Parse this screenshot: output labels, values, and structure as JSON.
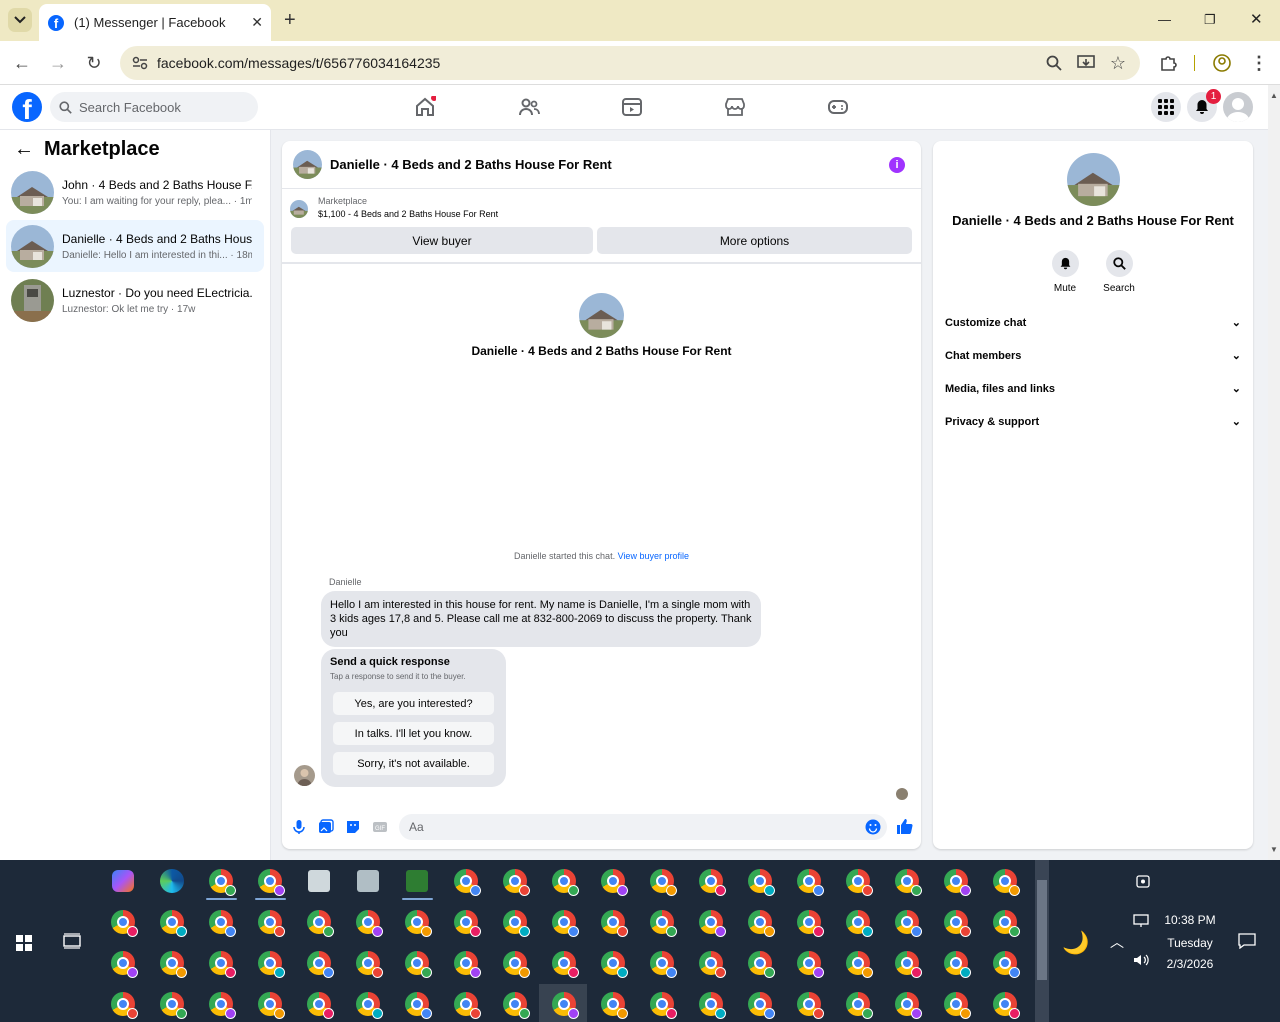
{
  "browser": {
    "tab_title": "(1) Messenger | Facebook",
    "url": "facebook.com/messages/t/656776034164235"
  },
  "facebook": {
    "search_placeholder": "Search Facebook",
    "notification_count": "1"
  },
  "left_panel": {
    "title": "Marketplace",
    "conversations": [
      {
        "name": "John · 4 Beds and 2 Baths House F...",
        "preview": "You: I am waiting for your reply, plea... · 1m"
      },
      {
        "name": "Danielle · 4 Beds and 2 Baths Hous...",
        "preview": "Danielle: Hello I am interested in thi... · 18m"
      },
      {
        "name": "Luznestor · Do you need ELectricia...",
        "preview": "Luznestor: Ok let me try · 17w"
      }
    ]
  },
  "chat": {
    "title": "Danielle · 4 Beds and 2 Baths House For Rent",
    "marketplace_label": "Marketplace",
    "listing": "$1,100 - 4 Beds and 2 Baths House For Rent",
    "view_buyer": "View buyer",
    "more_options": "More options",
    "center_name": "Danielle · 4 Beds and 2 Baths House For Rent",
    "started_text": "Danielle started this chat.",
    "view_buyer_profile": "View buyer profile",
    "sender": "Danielle",
    "message": "Hello I am interested in this house for rent. My name is Danielle, I'm a single mom with 3 kids ages 17,8 and 5. Please call me at 832-800-2069 to discuss the property. Thank you",
    "quick_title": "Send a quick response",
    "quick_sub": "Tap a response to send it to the buyer.",
    "quick_responses": [
      "Yes, are you interested?",
      "In talks. I'll let you know.",
      "Sorry, it's not available."
    ],
    "composer_placeholder": "Aa"
  },
  "details": {
    "name": "Danielle · 4 Beds and 2 Baths House For Rent",
    "mute": "Mute",
    "search": "Search",
    "sections": [
      "Customize chat",
      "Chat members",
      "Media, files and links",
      "Privacy & support"
    ]
  },
  "taskbar": {
    "time": "10:38 PM",
    "day": "Tuesday",
    "date": "2/3/2026"
  },
  "colors": {
    "fb_blue": "#0866ff",
    "selected_conv": "#ebf5ff",
    "taskbar": "#1d2939"
  }
}
